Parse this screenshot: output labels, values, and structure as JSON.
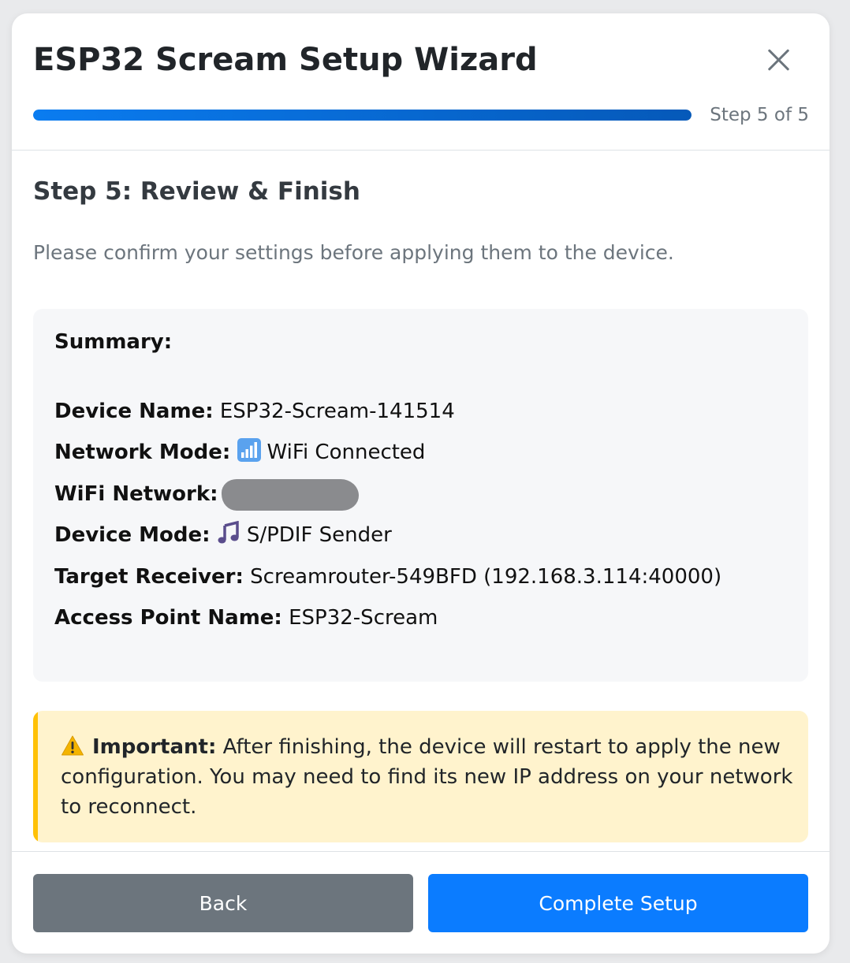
{
  "header": {
    "title": "ESP32 Scream Setup Wizard",
    "step_indicator": "Step 5 of 5",
    "progress_fraction": 1.0
  },
  "body": {
    "step_title": "Step 5: Review & Finish",
    "instruction": "Please confirm your settings before applying them to the device.",
    "summary": {
      "heading": "Summary:",
      "device_name": {
        "label": "Device Name:",
        "value": "ESP32-Scream-141514"
      },
      "network_mode": {
        "label": "Network Mode:",
        "icon": "signal-bars-icon",
        "value": "WiFi Connected"
      },
      "wifi_network": {
        "label": "WiFi Network:"
      },
      "device_mode": {
        "label": "Device Mode:",
        "icon": "music-note-icon",
        "value": "S/PDIF Sender"
      },
      "target_receiver": {
        "label": "Target Receiver:",
        "value": "Screamrouter-549BFD (192.168.3.114:40000)"
      },
      "access_point": {
        "label": "Access Point Name:",
        "value": "ESP32-Scream"
      }
    },
    "warning": {
      "icon": "warning-icon",
      "label": "Important:",
      "text": "After finishing, the device will restart to apply the new configuration. You may need to find its new IP address on your network to reconnect."
    }
  },
  "footer": {
    "back_label": "Back",
    "complete_label": "Complete Setup"
  },
  "colors": {
    "primary": "#0b7cff",
    "secondary": "#6c757d",
    "warning_bg": "#fff3cd",
    "warning_accent": "#ffc107"
  }
}
